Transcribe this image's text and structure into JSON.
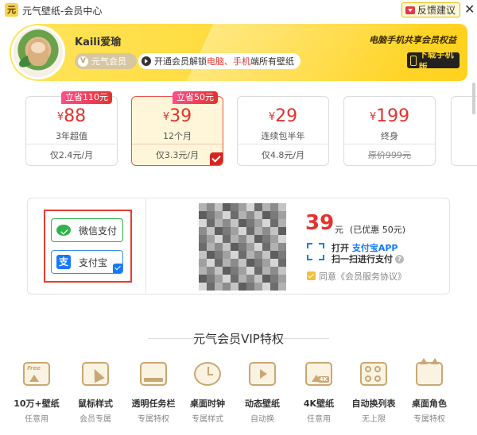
{
  "window": {
    "title": "元气壁纸-会员中心",
    "logo_text": "元",
    "feedback_label": "反馈建议",
    "close_symbol": "✕"
  },
  "header": {
    "username": "Kaili爱瑜",
    "member_badge": "元气会员",
    "member_badge_icon": "V",
    "promo_prefix": "开通会员解锁",
    "promo_highlight": "电脑、手机",
    "promo_suffix": "端所有壁纸",
    "slogan": "电脑手机共享会员权益",
    "download_label": "下载手机版",
    "colors": {
      "banner": "#ffd21f",
      "accent": "#e2332f"
    }
  },
  "plans": [
    {
      "currency": "¥",
      "price": "88",
      "term": "3年超值",
      "monthly": "仅2.4元/月",
      "badge": "立省110元",
      "selected": false,
      "strike": false
    },
    {
      "currency": "¥",
      "price": "39",
      "term": "12个月",
      "monthly": "仅3.3元/月",
      "badge": "立省50元",
      "selected": true,
      "strike": false
    },
    {
      "currency": "¥",
      "price": "29",
      "term": "连续包半年",
      "monthly": "仅4.8元/月",
      "badge": "",
      "selected": false,
      "strike": false
    },
    {
      "currency": "¥",
      "price": "199",
      "term": "终身",
      "monthly": "原价999元",
      "badge": "",
      "selected": false,
      "strike": true
    }
  ],
  "payment": {
    "methods": [
      {
        "label": "微信支付",
        "icon": "wechat-icon",
        "selected": false
      },
      {
        "label": "支付宝",
        "icon": "alipay-icon",
        "selected": true
      }
    ],
    "amount": "39",
    "unit": "元",
    "discount": "(已优惠 50元)",
    "scan_open": "打开",
    "scan_app": "支付宝APP",
    "scan_line2": "扫一扫进行支付",
    "help_symbol": "?",
    "agreement": "同意《会员服务协议》"
  },
  "vip": {
    "title": "元气会员VIP特权",
    "features": [
      {
        "name": "10万+壁纸",
        "sub": "任意用",
        "icon": "free-wallpaper-icon",
        "tag": "Free"
      },
      {
        "name": "鼠标样式",
        "sub": "会员专属",
        "icon": "cursor-style-icon",
        "tag": ""
      },
      {
        "name": "透明任务栏",
        "sub": "专属特权",
        "icon": "taskbar-icon",
        "tag": ""
      },
      {
        "name": "桌面时钟",
        "sub": "专属样式",
        "icon": "clock-icon",
        "tag": ""
      },
      {
        "name": "动态壁纸",
        "sub": "自动换",
        "icon": "video-wallpaper-icon",
        "tag": ""
      },
      {
        "name": "4K壁纸",
        "sub": "任意用",
        "icon": "4k-wallpaper-icon",
        "tag": "4K"
      },
      {
        "name": "自动换列表",
        "sub": "无上限",
        "icon": "auto-list-icon",
        "tag": ""
      },
      {
        "name": "桌面角色",
        "sub": "专属特权",
        "icon": "desktop-character-icon",
        "tag": ""
      }
    ]
  }
}
